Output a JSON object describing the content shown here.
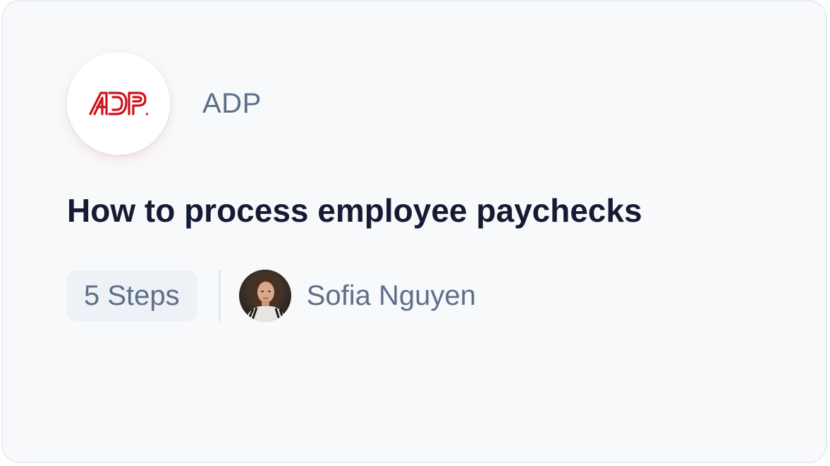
{
  "company": {
    "name": "ADP",
    "logo_text": "ADP",
    "logo_icon": "adp-logo",
    "brand_color": "#d0111b"
  },
  "guide": {
    "title": "How to process employee paychecks",
    "steps_label": "5 Steps"
  },
  "author": {
    "name": "Sofia Nguyen",
    "avatar_icon": "author-avatar"
  },
  "colors": {
    "card_background": "#f8f9fb",
    "title_text": "#141b33",
    "muted_text": "#5d7089",
    "badge_background": "#eef1f6"
  }
}
